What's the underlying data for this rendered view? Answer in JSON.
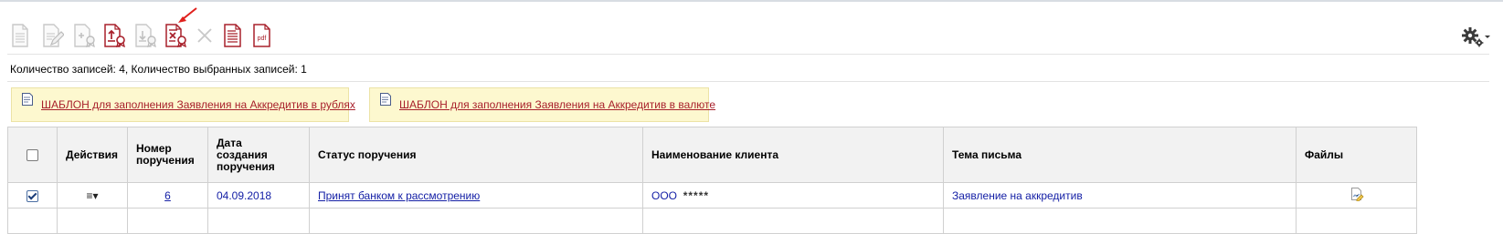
{
  "toolbar": {
    "icons": [
      {
        "name": "new-document-icon",
        "enabled": false
      },
      {
        "name": "edit-document-icon",
        "enabled": false
      },
      {
        "name": "sign-document-icon",
        "enabled": false
      },
      {
        "name": "send-signed-icon",
        "enabled": true
      },
      {
        "name": "receive-signed-icon",
        "enabled": false
      },
      {
        "name": "remove-signature-icon",
        "enabled": true
      },
      {
        "name": "delete-icon",
        "enabled": false
      },
      {
        "name": "print-document-icon",
        "enabled": true
      },
      {
        "name": "export-pdf-icon",
        "enabled": true,
        "label": "pdf"
      }
    ],
    "settings_icon": "gear-icon"
  },
  "summary": "Количество записей: 4, Количество выбранных записей: 1",
  "templates": [
    {
      "label": "ШАБЛОН для заполнения Заявления на Аккредитив в рублях"
    },
    {
      "label": "ШАБЛОН для заполнения Заявления на Аккредитив в валюте"
    }
  ],
  "table": {
    "headers": {
      "actions": "Действия",
      "number": [
        "Номер",
        "поручения"
      ],
      "date": [
        "Дата",
        "создания",
        "поручения"
      ],
      "status": "Статус поручения",
      "client": "Наименование клиента",
      "subject": "Тема письма",
      "files": "Файлы"
    },
    "rows": [
      {
        "selected": true,
        "actions": "≡▾",
        "number": "6",
        "date": "04.09.2018",
        "status": "Принят банком к рассмотрению",
        "client_prefix": "ООО",
        "client_masked": "*****",
        "subject": "Заявление на аккредитив",
        "file_icon": "attachment-file-icon"
      }
    ]
  },
  "colors": {
    "accent_red": "#a8202b",
    "link_blue": "#1520a6",
    "template_bg": "#fdf8cf",
    "disabled_icon": "#c8c8c8"
  }
}
